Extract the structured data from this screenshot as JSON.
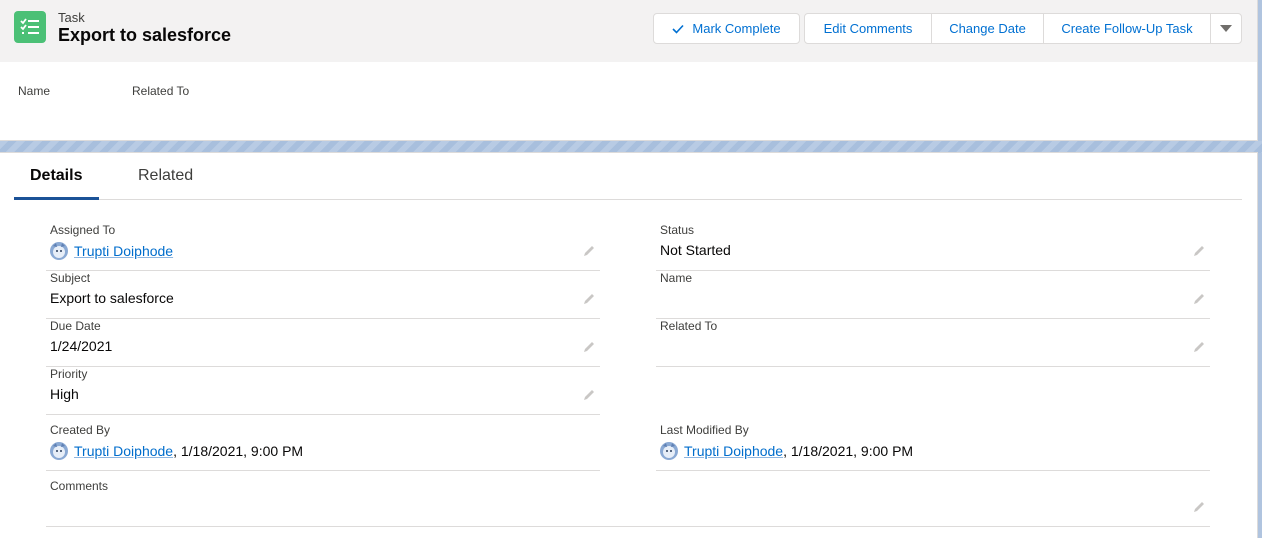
{
  "header": {
    "object_type": "Task",
    "title": "Export to salesforce",
    "icon": "task-checklist-icon",
    "buttons": {
      "mark_complete": "Mark Complete",
      "edit_comments": "Edit Comments",
      "change_date": "Change Date",
      "create_follow_up": "Create Follow-Up Task"
    },
    "highlights": {
      "name_label": "Name",
      "related_label": "Related To"
    }
  },
  "tabs": {
    "details": "Details",
    "related": "Related"
  },
  "fields": {
    "assigned_to": {
      "label": "Assigned To",
      "user": "Trupti Doiphode"
    },
    "status": {
      "label": "Status",
      "value": "Not Started"
    },
    "subject": {
      "label": "Subject",
      "value": "Export to salesforce"
    },
    "name": {
      "label": "Name",
      "value": ""
    },
    "due_date": {
      "label": "Due Date",
      "value": "1/24/2021"
    },
    "related_to": {
      "label": "Related To",
      "value": ""
    },
    "priority": {
      "label": "Priority",
      "value": "High"
    },
    "created_by": {
      "label": "Created By",
      "user": "Trupti Doiphode",
      "stamp": ", 1/18/2021, 9:00 PM"
    },
    "last_modified_by": {
      "label": "Last Modified By",
      "user": "Trupti Doiphode",
      "stamp": ", 1/18/2021, 9:00 PM"
    },
    "comments": {
      "label": "Comments",
      "value": ""
    }
  },
  "colors": {
    "accent": "#0070d2",
    "task_icon": "#4bc076",
    "tab_active": "#1b5297"
  }
}
